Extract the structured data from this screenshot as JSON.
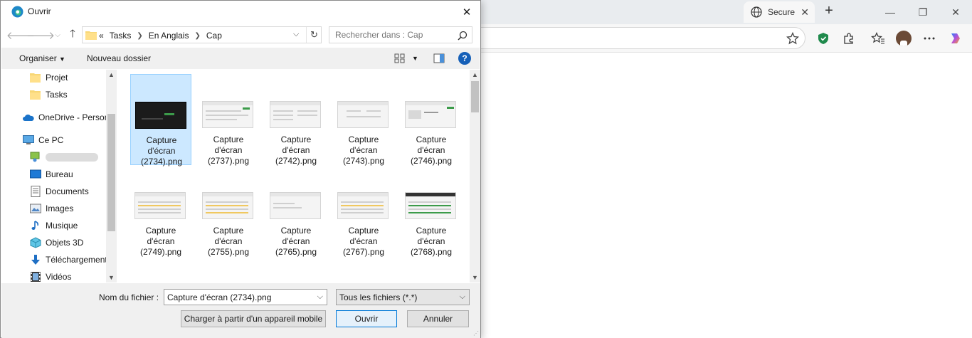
{
  "browser": {
    "tab_title": "Secure",
    "tab_close": "✕",
    "new_tab": "+",
    "window_controls": [
      "—",
      "❐",
      "✕"
    ]
  },
  "dialog": {
    "title": "Ouvrir",
    "close": "✕",
    "path": [
      "Tasks",
      "En Anglais",
      "Cap"
    ],
    "path_prefix": "«",
    "search_placeholder": "Rechercher dans : Cap",
    "commands": {
      "organize": "Organiser",
      "new_folder": "Nouveau dossier",
      "help": "?"
    },
    "nav_items": [
      {
        "label": "Projet",
        "icon": "folder-icon"
      },
      {
        "label": "Tasks",
        "icon": "folder-icon"
      },
      {
        "label": "OneDrive - Person",
        "icon": "onedrive-icon"
      },
      {
        "label": "Ce PC",
        "icon": "computer-icon"
      },
      {
        "label": "",
        "icon": "user-drive-icon"
      },
      {
        "label": "Bureau",
        "icon": "desktop-icon"
      },
      {
        "label": "Documents",
        "icon": "documents-icon"
      },
      {
        "label": "Images",
        "icon": "pictures-icon"
      },
      {
        "label": "Musique",
        "icon": "music-icon"
      },
      {
        "label": "Objets 3D",
        "icon": "objects3d-icon"
      },
      {
        "label": "Téléchargements",
        "icon": "downloads-icon"
      },
      {
        "label": "Vidéos",
        "icon": "videos-icon"
      }
    ],
    "files": [
      {
        "line1": "Capture",
        "line2": "d'écran",
        "line3": "(2734).png",
        "selected": true
      },
      {
        "line1": "Capture",
        "line2": "d'écran",
        "line3": "(2737).png"
      },
      {
        "line1": "Capture",
        "line2": "d'écran",
        "line3": "(2742).png"
      },
      {
        "line1": "Capture",
        "line2": "d'écran",
        "line3": "(2743).png"
      },
      {
        "line1": "Capture",
        "line2": "d'écran",
        "line3": "(2746).png"
      },
      {
        "line1": "Capture",
        "line2": "d'écran",
        "line3": "(2749).png"
      },
      {
        "line1": "Capture",
        "line2": "d'écran",
        "line3": "(2755).png"
      },
      {
        "line1": "Capture",
        "line2": "d'écran",
        "line3": "(2765).png"
      },
      {
        "line1": "Capture",
        "line2": "d'écran",
        "line3": "(2767).png"
      },
      {
        "line1": "Capture",
        "line2": "d'écran",
        "line3": "(2768).png"
      }
    ],
    "filename_label": "Nom du fichier :",
    "filename_value": "Capture d'écran (2734).png",
    "filter_value": "Tous les fichiers (*.*)",
    "mobile_button": "Charger à partir d'un appareil mobile",
    "open_button": "Ouvrir",
    "cancel_button": "Annuler"
  }
}
